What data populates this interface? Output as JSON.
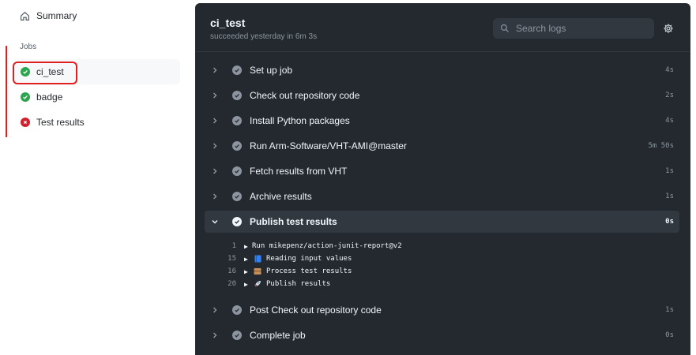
{
  "sidebar": {
    "summary_label": "Summary",
    "jobs_heading": "Jobs",
    "jobs": [
      {
        "label": "ci_test",
        "status": "success"
      },
      {
        "label": "badge",
        "status": "success"
      },
      {
        "label": "Test results",
        "status": "failure"
      }
    ]
  },
  "job": {
    "title": "ci_test",
    "subtitle": "succeeded yesterday in 6m 3s"
  },
  "search": {
    "placeholder": "Search logs"
  },
  "steps": [
    {
      "name": "Set up job",
      "duration": "4s"
    },
    {
      "name": "Check out repository code",
      "duration": "2s"
    },
    {
      "name": "Install Python packages",
      "duration": "4s"
    },
    {
      "name": "Run Arm-Software/VHT-AMI@master",
      "duration": "5m 50s"
    },
    {
      "name": "Fetch results from VHT",
      "duration": "1s"
    },
    {
      "name": "Archive results",
      "duration": "1s"
    },
    {
      "name": "Publish test results",
      "duration": "0s",
      "expanded": true
    },
    {
      "name": "Post Check out repository code",
      "duration": "1s"
    },
    {
      "name": "Complete job",
      "duration": "0s"
    }
  ],
  "log_lines": [
    {
      "line": "1",
      "text": "Run mikepenz/action-junit-report@v2",
      "icon": ""
    },
    {
      "line": "15",
      "text": "Reading input values",
      "icon": "book-icon"
    },
    {
      "line": "16",
      "text": "Process test results",
      "icon": "package-icon"
    },
    {
      "line": "20",
      "text": "Publish results",
      "icon": "rocket-icon"
    }
  ],
  "colors": {
    "success": "#2da44e",
    "failure": "#cf222e",
    "panel_bg": "#24292f",
    "highlight": "#e02020"
  }
}
